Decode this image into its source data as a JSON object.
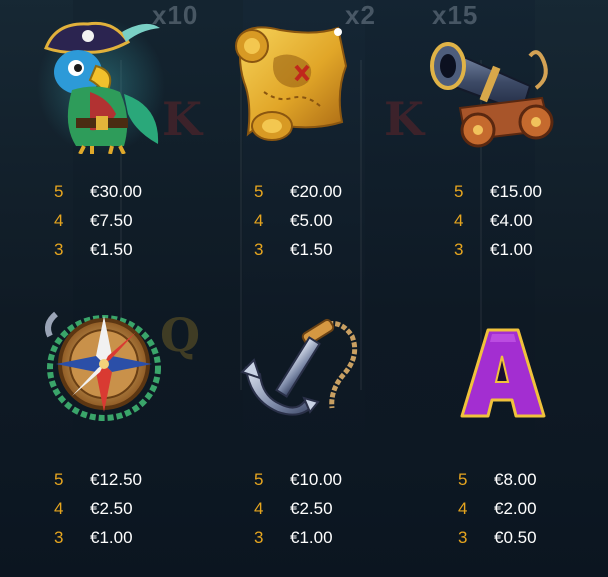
{
  "background": {
    "multipliers": [
      "x10",
      "x2",
      "x15"
    ],
    "ghost_letters": [
      "K",
      "K",
      "Q"
    ]
  },
  "symbols": [
    {
      "name": "parrot",
      "pays": [
        {
          "count": "5",
          "amount": "€30.00"
        },
        {
          "count": "4",
          "amount": "€7.50"
        },
        {
          "count": "3",
          "amount": "€1.50"
        }
      ]
    },
    {
      "name": "treasure-map",
      "pays": [
        {
          "count": "5",
          "amount": "€20.00"
        },
        {
          "count": "4",
          "amount": "€5.00"
        },
        {
          "count": "3",
          "amount": "€1.50"
        }
      ]
    },
    {
      "name": "cannon",
      "pays": [
        {
          "count": "5",
          "amount": "€15.00"
        },
        {
          "count": "4",
          "amount": "€4.00"
        },
        {
          "count": "3",
          "amount": "€1.00"
        }
      ]
    },
    {
      "name": "compass",
      "pays": [
        {
          "count": "5",
          "amount": "€12.50"
        },
        {
          "count": "4",
          "amount": "€2.50"
        },
        {
          "count": "3",
          "amount": "€1.00"
        }
      ]
    },
    {
      "name": "anchor",
      "pays": [
        {
          "count": "5",
          "amount": "€10.00"
        },
        {
          "count": "4",
          "amount": "€2.50"
        },
        {
          "count": "3",
          "amount": "€1.00"
        }
      ]
    },
    {
      "name": "letter-a",
      "letter": "A",
      "pays": [
        {
          "count": "5",
          "amount": "€8.00"
        },
        {
          "count": "4",
          "amount": "€2.00"
        },
        {
          "count": "3",
          "amount": "€0.50"
        }
      ]
    }
  ],
  "colors": {
    "count": "#e6a51f",
    "amount": "#ffffff",
    "letter_a": "#a32ed1"
  }
}
